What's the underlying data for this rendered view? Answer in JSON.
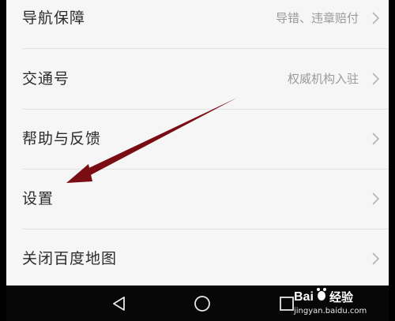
{
  "menu": {
    "items": [
      {
        "label": "导航保障",
        "value": "导错、违章赔付"
      },
      {
        "label": "交通号",
        "value": "权威机构入驻"
      },
      {
        "label": "帮助与反馈",
        "value": ""
      },
      {
        "label": "设置",
        "value": ""
      },
      {
        "label": "关闭百度地图",
        "value": ""
      }
    ]
  },
  "navbar": {
    "buttons": [
      "back",
      "home",
      "recents"
    ]
  },
  "watermark": {
    "logo": "Baidu经验",
    "text": "经验",
    "url": "jingyan.baidu.com"
  },
  "colors": {
    "background": "#f6f6f6",
    "text": "#2b2b2b",
    "secondary_text": "#9a9a9a",
    "arrow": "#7a0d14",
    "navbar": "#070707"
  }
}
